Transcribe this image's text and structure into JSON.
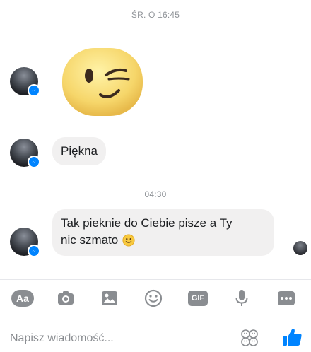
{
  "conversation": {
    "timestamp_top": "ŚR. O 16:45",
    "timestamp_mid": "04:30",
    "messages": [
      {
        "type": "sticker",
        "icon": "wink-emoji-sticker"
      },
      {
        "type": "text",
        "text": "Piękna"
      },
      {
        "type": "text",
        "line1": "Tak pieknie do Ciebie pisze a Ty",
        "line2": "nic szmato",
        "emoji": "slightly-smiling-emoji"
      }
    ]
  },
  "toolbar": {
    "aa_label": "Aa",
    "gif_label": "GIF",
    "icons": [
      "camera-icon",
      "image-icon",
      "emoji-icon",
      "microphone-icon",
      "more-icon"
    ]
  },
  "composer": {
    "placeholder": "Napisz wiadomość...",
    "sticker_icon": "sticker-icon",
    "like_icon": "thumbs-up-icon"
  },
  "colors": {
    "accent": "#0084ff",
    "bubble": "#f1f0f0",
    "icon_gray": "#8a8d91"
  }
}
